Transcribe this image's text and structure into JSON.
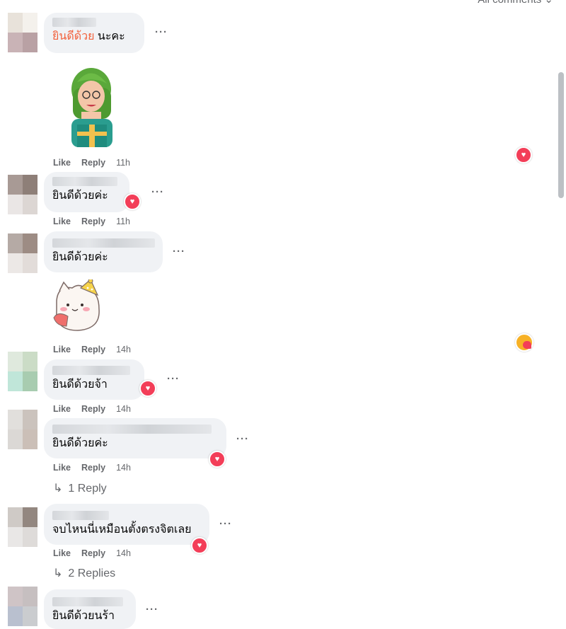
{
  "header": {
    "filter_label": "All comments ⌄"
  },
  "comments": [
    {
      "label": "ยินดีด้วย",
      "text": " นะคะ"
    },
    {
      "text": "ยินดีด้วยค่ะ"
    },
    {
      "text": "ยินดีด้วยค่ะ"
    },
    {
      "text": "ยินดีด้วยจ้า"
    },
    {
      "text": "ยินดีด้วยค่ะ"
    },
    {
      "text": "จบไหนนี่เหมือนตั้งตรงจิตเลย"
    },
    {
      "text": "ยินดีด้วยนร้า"
    }
  ],
  "actions": {
    "like": "Like",
    "reply": "Reply"
  },
  "times": [
    "11h",
    "11h",
    "14h",
    "14h",
    "14h",
    "14h"
  ],
  "more": "···",
  "replies": [
    "1 Reply",
    "2 Replies"
  ],
  "colors": {
    "reaction_heart": "#f33e58",
    "mention": "#f2603b",
    "bubble": "#f0f2f5"
  }
}
